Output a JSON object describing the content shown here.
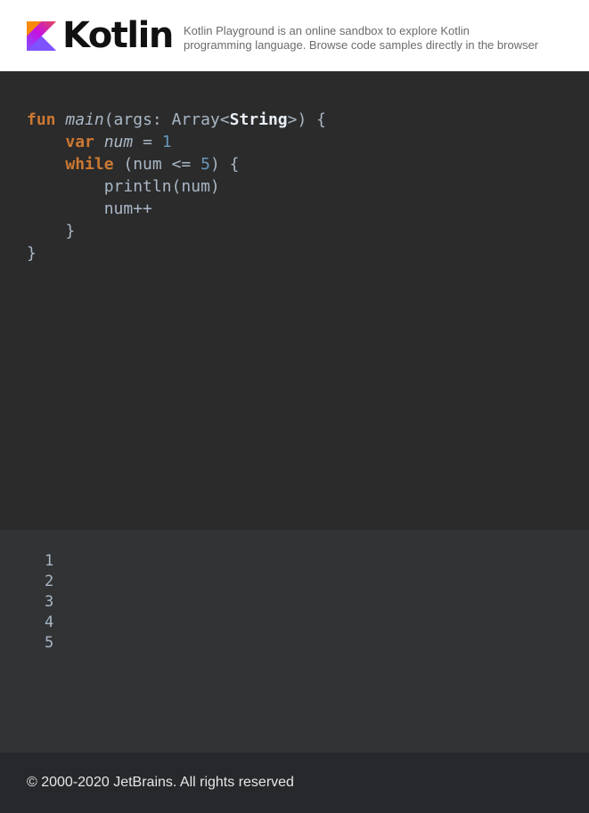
{
  "header": {
    "brand": "Kotlin",
    "description_line1": "Kotlin Playground is an online sandbox to explore Kotlin",
    "description_line2": "programming language. Browse code samples directly in the browser"
  },
  "editor": {
    "lines": [
      [
        {
          "text": "fun",
          "kind": "kw"
        },
        {
          "text": " ",
          "kind": "plain"
        },
        {
          "text": "main",
          "kind": "fn"
        },
        {
          "text": "(args: Array<",
          "kind": "plain"
        },
        {
          "text": "String",
          "kind": "ty-b"
        },
        {
          "text": ">) {",
          "kind": "plain"
        }
      ],
      [
        {
          "text": "    ",
          "kind": "plain"
        },
        {
          "text": "var",
          "kind": "kw"
        },
        {
          "text": " ",
          "kind": "plain"
        },
        {
          "text": "num",
          "kind": "var"
        },
        {
          "text": " = ",
          "kind": "plain"
        },
        {
          "text": "1",
          "kind": "num"
        }
      ],
      [
        {
          "text": "    ",
          "kind": "plain"
        },
        {
          "text": "while",
          "kind": "kw"
        },
        {
          "text": " (num <= ",
          "kind": "plain"
        },
        {
          "text": "5",
          "kind": "num"
        },
        {
          "text": ") {",
          "kind": "plain"
        }
      ],
      [
        {
          "text": "        println(num)",
          "kind": "plain"
        }
      ],
      [
        {
          "text": "        num++",
          "kind": "plain"
        }
      ],
      [
        {
          "text": "    }",
          "kind": "plain"
        }
      ],
      [
        {
          "text": "}",
          "kind": "plain"
        }
      ]
    ]
  },
  "output": {
    "lines": [
      "1",
      "2",
      "3",
      "4",
      "5"
    ]
  },
  "footer": {
    "copyright": "© 2000-2020 JetBrains. All rights reserved"
  },
  "colors": {
    "keyword": "#cc7832",
    "number": "#6897bb",
    "text": "#a9b7c6",
    "editor_bg": "#2b2b2b",
    "output_bg": "#313335",
    "footer_bg": "#27282c"
  }
}
